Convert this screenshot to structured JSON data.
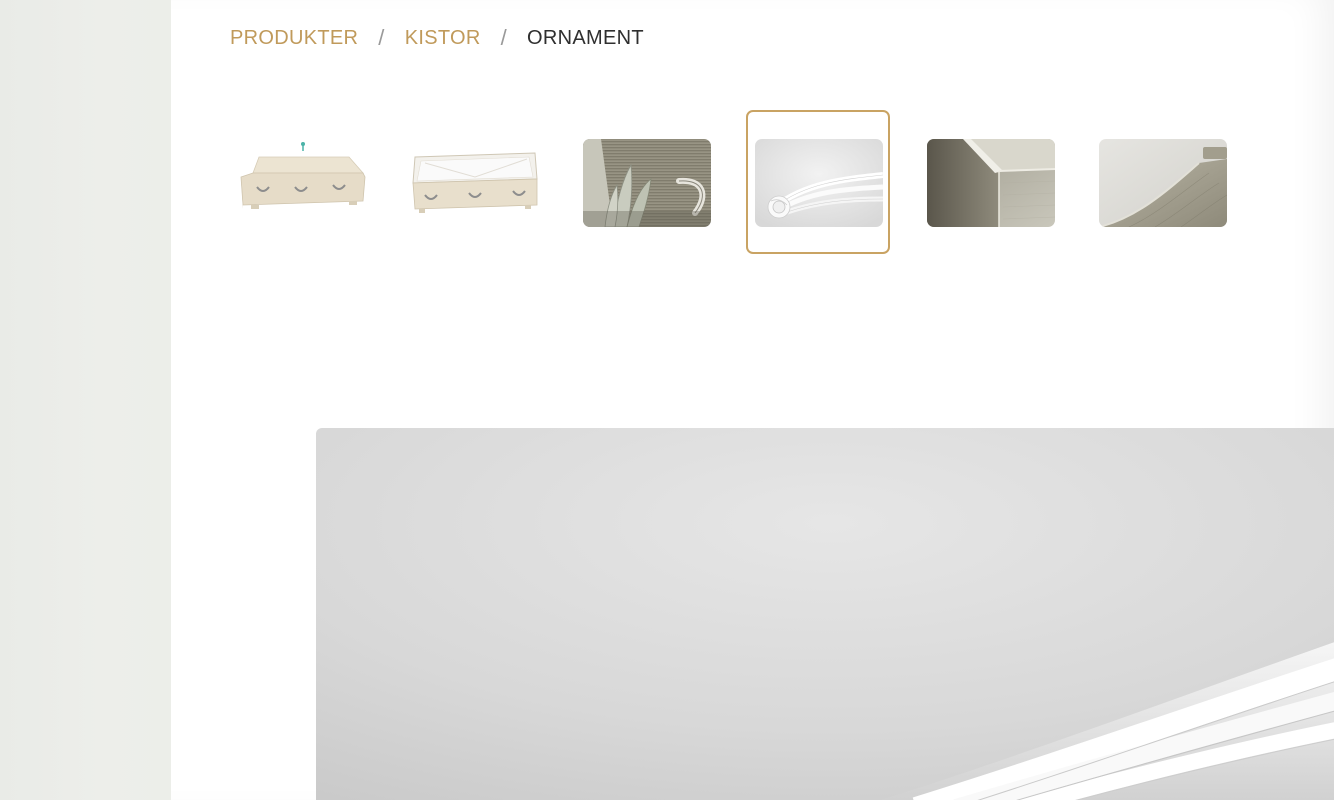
{
  "breadcrumb": {
    "items": [
      {
        "label": "PRODUKTER"
      },
      {
        "label": "KISTOR"
      }
    ],
    "separator": "/",
    "current": "ORNAMENT"
  },
  "gallery": {
    "selected_index": 3,
    "thumbnails": [
      {
        "name": "closed-coffin"
      },
      {
        "name": "open-coffin"
      },
      {
        "name": "leaf-ornament-handle"
      },
      {
        "name": "white-fabric-rosette"
      },
      {
        "name": "wood-edge-detail"
      },
      {
        "name": "curved-wood-lid"
      }
    ]
  },
  "colors": {
    "accent_gold": "#c09a5b",
    "selected_border": "#c9a363",
    "current_crumb": "#2f2f2f",
    "rail_background": "#ecede9"
  }
}
